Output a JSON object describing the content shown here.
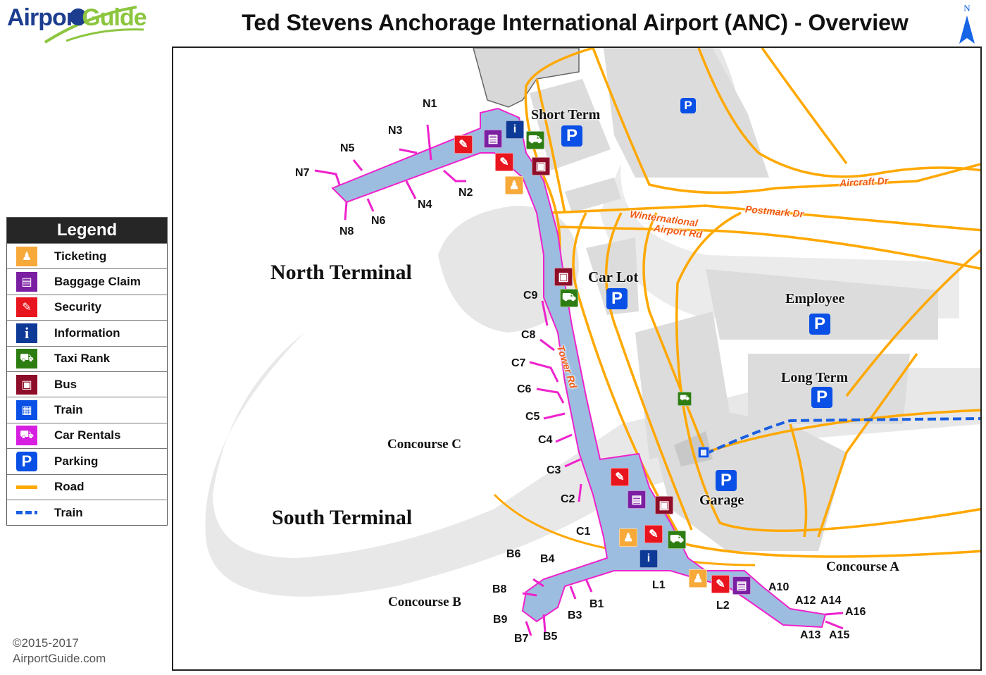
{
  "header": {
    "logo_part1": "Airport",
    "logo_part2": "Guide",
    "title": "Ted Stevens Anchorage International Airport (ANC) - Overview",
    "north_label": "N"
  },
  "legend": {
    "title": "Legend",
    "items": [
      {
        "label": "Ticketing",
        "icon": "ticketing-icon",
        "color": "#f7a93a"
      },
      {
        "label": "Baggage Claim",
        "icon": "baggage-claim-icon",
        "color": "#7b1fa2"
      },
      {
        "label": "Security",
        "icon": "security-icon",
        "color": "#e8141e"
      },
      {
        "label": "Information",
        "icon": "information-icon",
        "color": "#0d3a96"
      },
      {
        "label": "Taxi Rank",
        "icon": "taxi-icon",
        "color": "#2e7d12"
      },
      {
        "label": "Bus",
        "icon": "bus-icon",
        "color": "#8e0e2a"
      },
      {
        "label": "Train",
        "icon": "train-icon",
        "color": "#0a50e6"
      },
      {
        "label": "Car Rentals",
        "icon": "car-rental-icon",
        "color": "#d61fe0"
      },
      {
        "label": "Parking",
        "icon": "parking-icon",
        "color": "#0a50e6"
      },
      {
        "label": "Road",
        "icon": "road-line-icon",
        "color": "#ffa800"
      },
      {
        "label": "Train",
        "icon": "train-line-icon",
        "color": "#1a5fe0"
      }
    ]
  },
  "copyright": {
    "line1": "©2015-2017",
    "line2": "AirportGuide.com"
  },
  "map": {
    "areas": {
      "north_terminal": "North Terminal",
      "south_terminal": "South Terminal",
      "concourse_a": "Concourse A",
      "concourse_b": "Concourse B",
      "concourse_c": "Concourse C"
    },
    "parking": {
      "short_term": "Short Term",
      "car_lot": "Car Lot",
      "employee": "Employee",
      "long_term": "Long Term",
      "garage": "Garage",
      "symbol": "P"
    },
    "roads": {
      "aircraft_dr": "Aircraft Dr",
      "postmark_dr": "Postmark Dr",
      "winternational_1": "Winternational",
      "winternational_2": "Airport Rd",
      "tower_rd": "Tower Rd"
    },
    "gates": {
      "n": [
        "N1",
        "N2",
        "N3",
        "N4",
        "N5",
        "N6",
        "N7",
        "N8"
      ],
      "c": [
        "C1",
        "C2",
        "C3",
        "C4",
        "C5",
        "C6",
        "C7",
        "C8",
        "C9"
      ],
      "b": [
        "B1",
        "B3",
        "B4",
        "B5",
        "B6",
        "B7",
        "B8",
        "B9"
      ],
      "a": [
        "A10",
        "A12",
        "A13",
        "A14",
        "A15",
        "A16"
      ],
      "l": [
        "L1",
        "L2"
      ]
    },
    "info_symbol": "i"
  }
}
